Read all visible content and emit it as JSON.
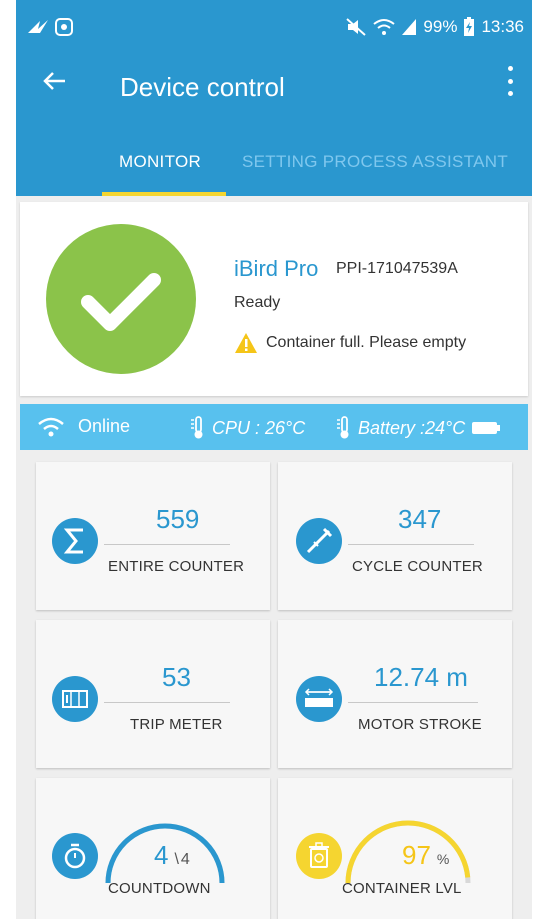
{
  "status_bar": {
    "battery": "99%",
    "time": "13:36"
  },
  "appbar": {
    "title": "Device control"
  },
  "tabs": [
    {
      "label": "MONITOR",
      "active": true
    },
    {
      "label": "SETTING PROCESS ASSISTANT",
      "active": false
    }
  ],
  "device": {
    "name": "iBird Pro",
    "serial": "PPI-171047539A",
    "state": "Ready",
    "warning": "Container full. Please empty"
  },
  "info_strip": {
    "connection": "Online",
    "cpu_label": "CPU : 26°C",
    "battery_label": "Battery :24°C"
  },
  "tiles": {
    "entire_counter": {
      "value": "559",
      "label": "ENTIRE COUNTER",
      "icon": "sigma-icon"
    },
    "cycle_counter": {
      "value": "347",
      "label": "CYCLE COUNTER",
      "icon": "injector-icon"
    },
    "trip_meter": {
      "value": "53",
      "label": "TRIP METER",
      "icon": "counter-icon"
    },
    "motor_stroke": {
      "value": "12.74 m",
      "label": "MOTOR STROKE",
      "icon": "ruler-icon"
    },
    "countdown": {
      "value": "4",
      "max": "4",
      "label": "COUNTDOWN",
      "icon": "stopwatch-icon",
      "fraction": 1.0
    },
    "container": {
      "value": "97",
      "unit": "%",
      "label": "CONTAINER LVL",
      "icon": "bin-icon",
      "percent": 97
    }
  },
  "colors": {
    "primary": "#2a97cf",
    "strip": "#58c1ee",
    "success": "#8bc34a",
    "warning": "#f5c518",
    "container_gauge": "#f5d530",
    "tab_indicator": "#f5d530"
  }
}
